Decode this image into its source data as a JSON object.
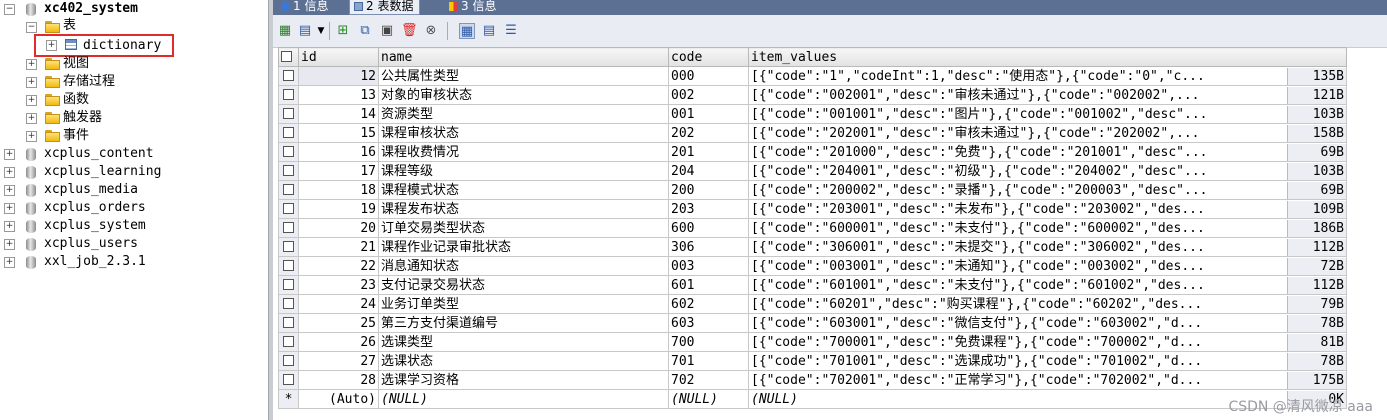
{
  "tree": {
    "root_db": "xc402_system",
    "tables_folder": "表",
    "selected_table": "dictionary",
    "folders": [
      "视图",
      "存储过程",
      "函数",
      "触发器",
      "事件"
    ],
    "other_dbs": [
      "xcplus_content",
      "xcplus_learning",
      "xcplus_media",
      "xcplus_orders",
      "xcplus_system",
      "xcplus_users",
      "xxl_job_2.3.1"
    ]
  },
  "tabs": [
    {
      "label": "1 信息"
    },
    {
      "label": "2 表数据"
    },
    {
      "label": "3 信息"
    }
  ],
  "toolbar": {
    "icons": [
      "grid-insert-icon",
      "export-dropdown-icon",
      "add-row-icon",
      "duplicate-row-icon",
      "save-icon",
      "delete-icon",
      "discard-icon",
      "grid-view-icon",
      "form-view-icon",
      "text-view-icon"
    ]
  },
  "grid": {
    "columns": [
      "id",
      "name",
      "code",
      "item_values"
    ],
    "rows": [
      {
        "id": "12",
        "name": "公共属性类型",
        "code": "000",
        "values": "[{\"code\":\"1\",\"codeInt\":1,\"desc\":\"使用态\"},{\"code\":\"0\",\"c...",
        "size": "135B"
      },
      {
        "id": "13",
        "name": "对象的审核状态",
        "code": "002",
        "values": "[{\"code\":\"002001\",\"desc\":\"审核未通过\"},{\"code\":\"002002\",...",
        "size": "121B"
      },
      {
        "id": "14",
        "name": "资源类型",
        "code": "001",
        "values": "[{\"code\":\"001001\",\"desc\":\"图片\"},{\"code\":\"001002\",\"desc\"...",
        "size": "103B"
      },
      {
        "id": "15",
        "name": "课程审核状态",
        "code": "202",
        "values": "[{\"code\":\"202001\",\"desc\":\"审核未通过\"},{\"code\":\"202002\",...",
        "size": "158B"
      },
      {
        "id": "16",
        "name": "课程收费情况",
        "code": "201",
        "values": "[{\"code\":\"201000\",\"desc\":\"免费\"},{\"code\":\"201001\",\"desc\"...",
        "size": "69B"
      },
      {
        "id": "17",
        "name": "课程等级",
        "code": "204",
        "values": "[{\"code\":\"204001\",\"desc\":\"初级\"},{\"code\":\"204002\",\"desc\"...",
        "size": "103B"
      },
      {
        "id": "18",
        "name": "课程模式状态",
        "code": "200",
        "values": "[{\"code\":\"200002\",\"desc\":\"录播\"},{\"code\":\"200003\",\"desc\"...",
        "size": "69B"
      },
      {
        "id": "19",
        "name": "课程发布状态",
        "code": "203",
        "values": "[{\"code\":\"203001\",\"desc\":\"未发布\"},{\"code\":\"203002\",\"des...",
        "size": "109B"
      },
      {
        "id": "20",
        "name": "订单交易类型状态",
        "code": "600",
        "values": "[{\"code\":\"600001\",\"desc\":\"未支付\"},{\"code\":\"600002\",\"des...",
        "size": "186B"
      },
      {
        "id": "21",
        "name": "课程作业记录审批状态",
        "code": "306",
        "values": "[{\"code\":\"306001\",\"desc\":\"未提交\"},{\"code\":\"306002\",\"des...",
        "size": "112B"
      },
      {
        "id": "22",
        "name": "消息通知状态",
        "code": "003",
        "values": "[{\"code\":\"003001\",\"desc\":\"未通知\"},{\"code\":\"003002\",\"des...",
        "size": "72B"
      },
      {
        "id": "23",
        "name": "支付记录交易状态",
        "code": "601",
        "values": "[{\"code\":\"601001\",\"desc\":\"未支付\"},{\"code\":\"601002\",\"des...",
        "size": "112B"
      },
      {
        "id": "24",
        "name": "业务订单类型",
        "code": "602",
        "values": "[{\"code\":\"60201\",\"desc\":\"购买课程\"},{\"code\":\"60202\",\"des...",
        "size": "79B"
      },
      {
        "id": "25",
        "name": "第三方支付渠道编号",
        "code": "603",
        "values": "[{\"code\":\"603001\",\"desc\":\"微信支付\"},{\"code\":\"603002\",\"d...",
        "size": "78B"
      },
      {
        "id": "26",
        "name": "选课类型",
        "code": "700",
        "values": "[{\"code\":\"700001\",\"desc\":\"免费课程\"},{\"code\":\"700002\",\"d...",
        "size": "81B"
      },
      {
        "id": "27",
        "name": "选课状态",
        "code": "701",
        "values": "[{\"code\":\"701001\",\"desc\":\"选课成功\"},{\"code\":\"701002\",\"d...",
        "size": "78B"
      },
      {
        "id": "28",
        "name": "选课学习资格",
        "code": "702",
        "values": "[{\"code\":\"702001\",\"desc\":\"正常学习\"},{\"code\":\"702002\",\"d...",
        "size": "175B"
      }
    ],
    "new_row": {
      "marker": "*",
      "id": "(Auto)",
      "name": "(NULL)",
      "code": "(NULL)",
      "values": "(NULL)",
      "size": "0K"
    }
  },
  "watermark": "CSDN @清风微凉 aaa"
}
